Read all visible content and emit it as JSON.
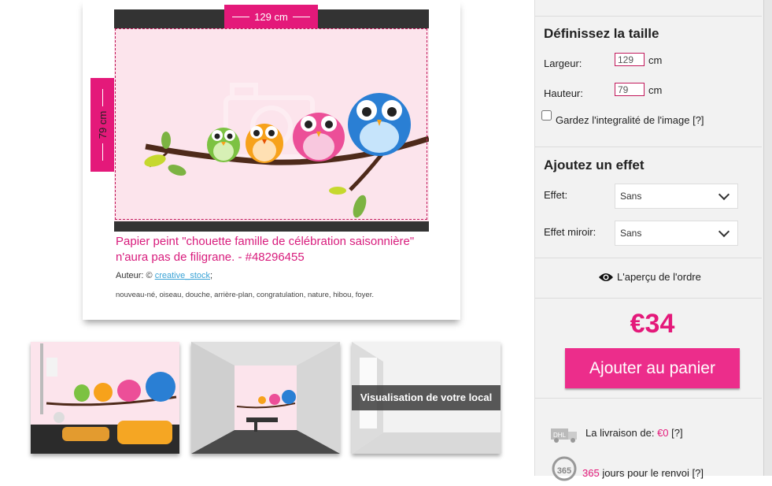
{
  "product": {
    "width_label": "129 cm",
    "height_label": "79 cm",
    "title": "Papier peint \"chouette famille de célébration saisonnière\"  n'aura pas de filigrane. - #48296455",
    "author_prefix": "Auteur: © ",
    "author_name": "creative_stock",
    "author_suffix": ";",
    "tags": "nouveau-né, oiseau, douche, arrière-plan, congratulation, nature, hibou, foyer."
  },
  "thumbnails": {
    "overlay_text": "Visualisation de votre local"
  },
  "size_section": {
    "heading": "Définissez la taille",
    "width_label": "Largeur:",
    "width_value": "129",
    "height_label": "Hauteur:",
    "height_value": "79",
    "unit": "cm",
    "keep_label": "Gardez l'integralité de l'image",
    "help": "[?]"
  },
  "effect_section": {
    "heading": "Ajoutez un effet",
    "effect_label": "Effet:",
    "effect_value": "Sans",
    "mirror_label": "Effet miroir:",
    "mirror_value": "Sans"
  },
  "preview": {
    "label": "L'aperçu de l'ordre"
  },
  "order": {
    "price": "€34",
    "cart_button": "Ajouter au panier"
  },
  "delivery": {
    "icon_text": "DHL",
    "label": "La livraison de: ",
    "price": "€0",
    "help": "[?]"
  },
  "returns": {
    "icon_text": "365",
    "days": "365",
    "label": " jours pour le renvoi ",
    "help": "[?]"
  },
  "colors": {
    "accent": "#e4197a",
    "button": "#ec2d8b",
    "image_bg": "#fce4ec"
  }
}
